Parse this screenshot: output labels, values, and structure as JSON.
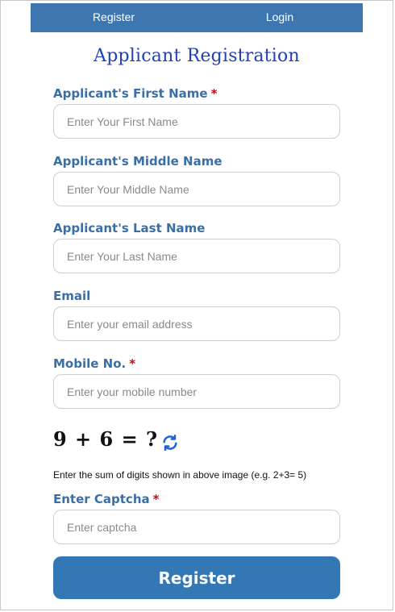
{
  "nav": {
    "register_label": "Register",
    "login_label": "Login"
  },
  "form": {
    "title": "Applicant Registration",
    "required_marker": "*",
    "first_name": {
      "label": "Applicant's First Name",
      "placeholder": "Enter Your First Name",
      "value": ""
    },
    "middle_name": {
      "label": "Applicant's Middle Name",
      "placeholder": "Enter Your Middle Name",
      "value": ""
    },
    "last_name": {
      "label": "Applicant's Last Name",
      "placeholder": "Enter Your Last Name",
      "value": ""
    },
    "email": {
      "label": "Email",
      "placeholder": "Enter your email address",
      "value": ""
    },
    "mobile": {
      "label": "Mobile No.",
      "placeholder": "Enter your mobile number",
      "value": ""
    },
    "captcha": {
      "expression": "9 + 6 = ?",
      "hint": "Enter the sum of digits shown in above image (e.g. 2+3= 5)",
      "label": "Enter Captcha",
      "placeholder": "Enter captcha",
      "value": ""
    },
    "submit_label": "Register"
  },
  "colors": {
    "nav_bg": "#3e77b0",
    "title": "#1f3fbf",
    "label": "#3a6fa6",
    "required": "#e00000",
    "button": "#3378b5",
    "refresh_icon": "#1e63d6"
  },
  "icons": {
    "refresh": "refresh-icon"
  }
}
